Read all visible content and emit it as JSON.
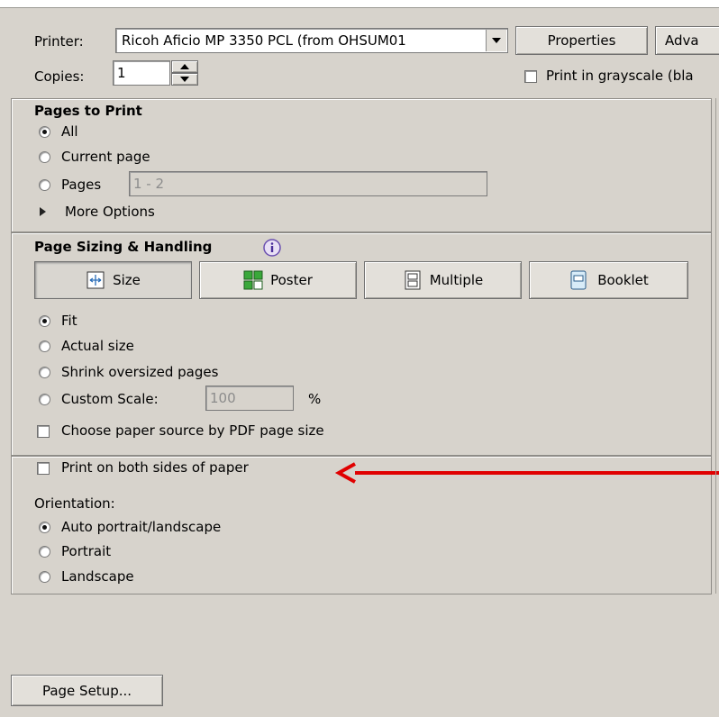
{
  "printer": {
    "label": "Printer:",
    "selected": "Ricoh Aficio MP 3350 PCL (from OHSUM01",
    "properties_button": "Properties",
    "advanced_button": "Adva"
  },
  "copies": {
    "label": "Copies:",
    "value": "1"
  },
  "grayscale": {
    "label": "Print in grayscale (bla",
    "checked": false
  },
  "pages_to_print": {
    "title": "Pages to Print",
    "options": [
      "All",
      "Current page",
      "Pages"
    ],
    "selected": "All",
    "pages_value": "1 - 2",
    "more_options": "More Options"
  },
  "sizing": {
    "title": "Page Sizing & Handling",
    "tabs": [
      "Size",
      "Poster",
      "Multiple",
      "Booklet"
    ],
    "active_tab": "Size",
    "options": [
      "Fit",
      "Actual size",
      "Shrink oversized pages",
      "Custom Scale:"
    ],
    "selected": "Fit",
    "scale_value": "100",
    "scale_unit": "%",
    "paper_source_label": "Choose paper source by PDF page size"
  },
  "duplex": {
    "label": "Print on both sides of paper",
    "checked": false
  },
  "orientation": {
    "title": "Orientation:",
    "options": [
      "Auto portrait/landscape",
      "Portrait",
      "Landscape"
    ],
    "selected": "Auto portrait/landscape"
  },
  "page_setup_button": "Page Setup...",
  "colors": {
    "annotation_arrow": "#e00000",
    "panel_bg": "#d7d3cc"
  }
}
